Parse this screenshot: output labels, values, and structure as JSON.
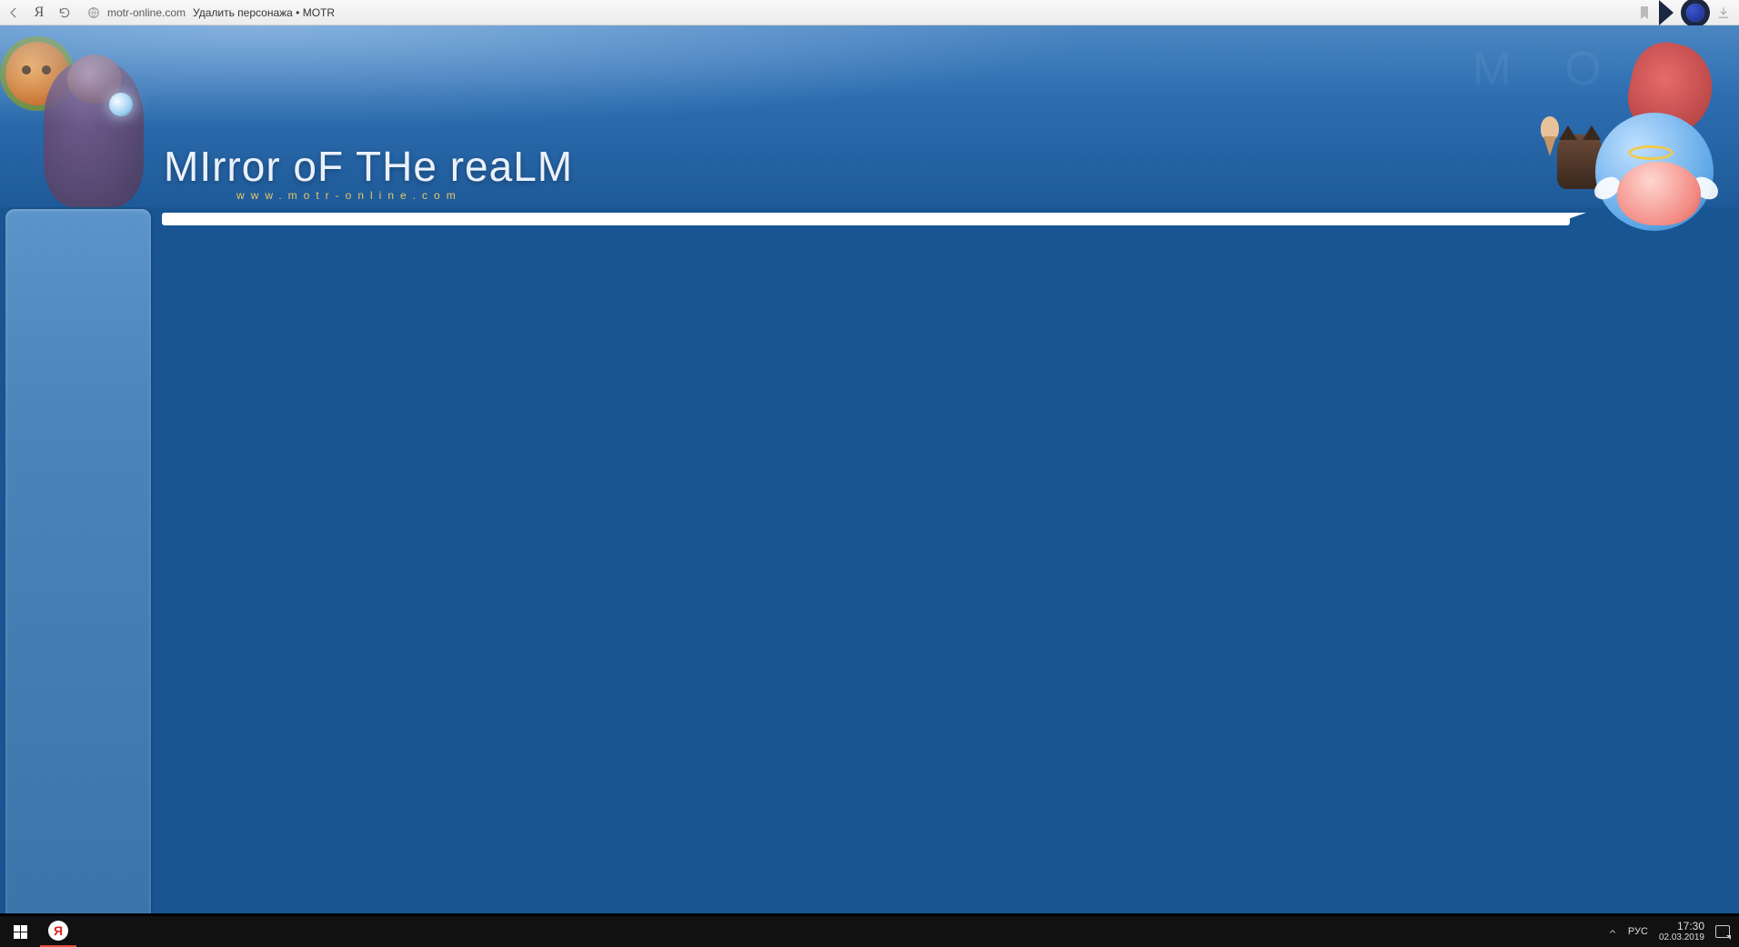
{
  "browser": {
    "domain": "motr-online.com",
    "title": "Удалить персонажа • MOTR"
  },
  "page": {
    "logo_title": "MIrror oF THe reaLM",
    "logo_sub": "www.motr-online.com",
    "watermark": "M O T"
  },
  "taskbar": {
    "lang": "РУС",
    "time": "17:30",
    "date": "02.03.2019",
    "app_letter": "Я"
  }
}
